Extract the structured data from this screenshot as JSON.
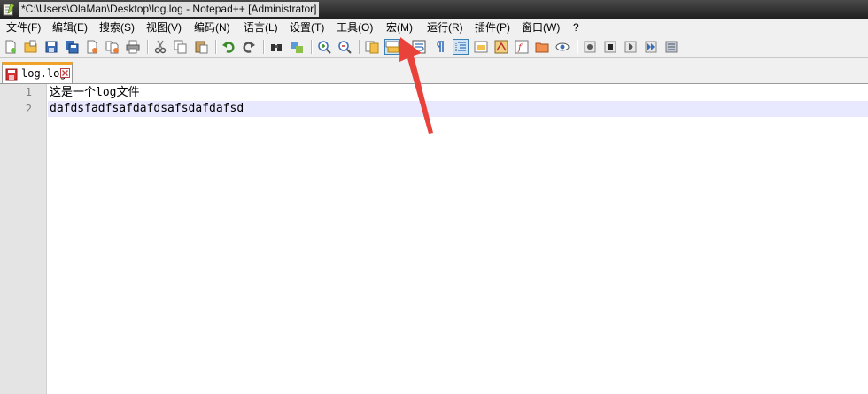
{
  "window": {
    "title": "*C:\\Users\\OlaMan\\Desktop\\log.log - Notepad++ [Administrator]"
  },
  "menu": [
    {
      "label": "文件(F)",
      "name": "menu-file"
    },
    {
      "label": "编辑(E)",
      "name": "menu-edit"
    },
    {
      "label": "搜索(S)",
      "name": "menu-search"
    },
    {
      "label": "视图(V)",
      "name": "menu-view"
    },
    {
      "label": "编码(N)",
      "name": "menu-encoding"
    },
    {
      "label": "语言(L)",
      "name": "menu-language"
    },
    {
      "label": "设置(T)",
      "name": "menu-settings"
    },
    {
      "label": "工具(O)",
      "name": "menu-tools"
    },
    {
      "label": "宏(M)",
      "name": "menu-macro"
    },
    {
      "label": "运行(R)",
      "name": "menu-run"
    },
    {
      "label": "插件(P)",
      "name": "menu-plugins"
    },
    {
      "label": "窗口(W)",
      "name": "menu-window"
    },
    {
      "label": "?",
      "name": "menu-help"
    }
  ],
  "toolbar": {
    "icons": [
      "new-file-icon",
      "open-file-icon",
      "save-icon",
      "save-all-icon",
      "close-icon",
      "close-all-icon",
      "print-icon",
      "cut-icon",
      "copy-icon",
      "paste-icon",
      "undo-icon",
      "redo-icon",
      "find-icon",
      "replace-icon",
      "zoom-in-icon",
      "zoom-out-icon",
      "sync-vertical-icon",
      "sync-horizontal-icon",
      "word-wrap-icon",
      "show-all-chars-icon",
      "indent-guide-icon",
      "user-language-icon",
      "document-map-icon",
      "function-list-icon",
      "folder-workspace-icon",
      "monitoring-icon",
      "record-macro-icon",
      "stop-recording-icon",
      "play-macro-icon",
      "run-macro-multiple-icon",
      "save-macro-icon"
    ],
    "active": [
      "sync-horizontal-icon",
      "indent-guide-icon"
    ]
  },
  "tab": {
    "label": "log.log",
    "icon": "unsaved-file-icon",
    "close_icon": "tab-close-icon"
  },
  "editor": {
    "lines": [
      {
        "number": "1",
        "text": "这是一个log文件"
      },
      {
        "number": "2",
        "text": "dafdsfadfsafdafdsafsdafdafsd"
      }
    ],
    "current_line": 2
  },
  "colors": {
    "annotation_arrow": "#e8423a",
    "current_line_highlight": "#e8e8ff",
    "tab_accent": "#f0a32a"
  }
}
